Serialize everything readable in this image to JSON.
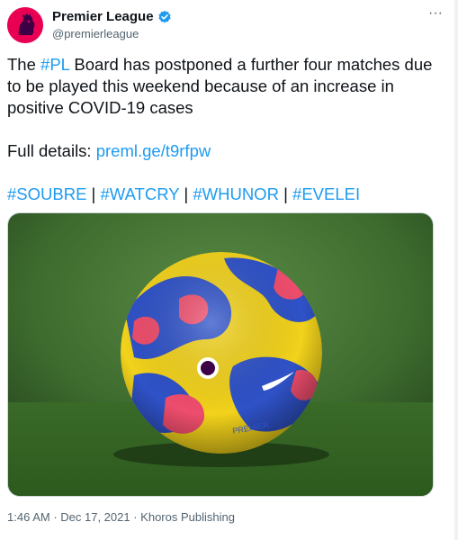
{
  "account": {
    "display_name": "Premier League",
    "handle": "@premierleague",
    "avatar_icon": "premier-league-lion-logo",
    "verified": true
  },
  "tweet": {
    "line1_prefix": "The ",
    "line1_hashtag": "#PL",
    "line1_rest": " Board has postponed a further four matches due to be played this weekend because of an increase in positive COVID-19 cases",
    "details_label": "Full details: ",
    "details_link": "preml.ge/t9rfpw",
    "hashtags": [
      "#SOUBRE",
      "#WATCRY",
      "#WHUNOR",
      "#EVELEI"
    ],
    "separator": " | "
  },
  "media": {
    "description_icon": "football-on-grass-photo"
  },
  "meta": {
    "time": "1:46 AM",
    "dot": " · ",
    "date": "Dec 17, 2021",
    "source": "Khoros Publishing"
  },
  "colors": {
    "link": "#1d9bf0",
    "brand": "#e90052",
    "text": "#0f1419",
    "muted": "#536471"
  }
}
